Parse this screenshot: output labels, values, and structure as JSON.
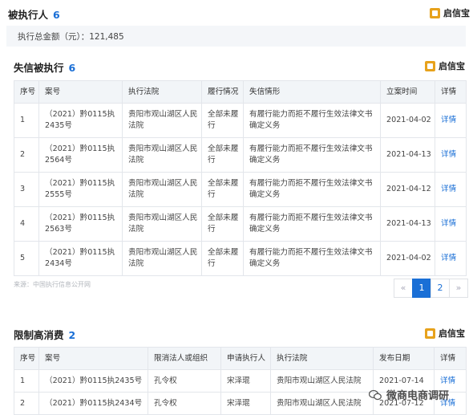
{
  "brand": {
    "name": "启信宝"
  },
  "executed": {
    "title": "被执行人",
    "count": "6",
    "total_label": "执行总金额（元）：121,485"
  },
  "dishonest": {
    "title": "失信被执行",
    "count": "6",
    "headers": [
      "序号",
      "案号",
      "执行法院",
      "履行情况",
      "失信情形",
      "立案时间",
      "详情"
    ],
    "rows": [
      {
        "no": "1",
        "case": "（2021）黔0115执2435号",
        "court": "贵阳市观山湖区人民法院",
        "status": "全部未履行",
        "situation": "有履行能力而拒不履行生效法律文书确定义务",
        "date": "2021-04-02",
        "detail": "详情"
      },
      {
        "no": "2",
        "case": "（2021）黔0115执2564号",
        "court": "贵阳市观山湖区人民法院",
        "status": "全部未履行",
        "situation": "有履行能力而拒不履行生效法律文书确定义务",
        "date": "2021-04-13",
        "detail": "详情"
      },
      {
        "no": "3",
        "case": "（2021）黔0115执2555号",
        "court": "贵阳市观山湖区人民法院",
        "status": "全部未履行",
        "situation": "有履行能力而拒不履行生效法律文书确定义务",
        "date": "2021-04-12",
        "detail": "详情"
      },
      {
        "no": "4",
        "case": "（2021）黔0115执2563号",
        "court": "贵阳市观山湖区人民法院",
        "status": "全部未履行",
        "situation": "有履行能力而拒不履行生效法律文书确定义务",
        "date": "2021-04-13",
        "detail": "详情"
      },
      {
        "no": "5",
        "case": "（2021）黔0115执2434号",
        "court": "贵阳市观山湖区人民法院",
        "status": "全部未履行",
        "situation": "有履行能力而拒不履行生效法律文书确定义务",
        "date": "2021-04-02",
        "detail": "详情"
      }
    ],
    "source": "来源：中国执行信息公开网",
    "pagination": {
      "prev": "«",
      "pages": [
        "1",
        "2"
      ],
      "current": "1",
      "next": "»"
    }
  },
  "restriction": {
    "title": "限制高消费",
    "count": "2",
    "headers": [
      "序号",
      "案号",
      "限消法人或组织",
      "申请执行人",
      "执行法院",
      "发布日期",
      "详情"
    ],
    "rows": [
      {
        "no": "1",
        "case": "（2021）黔0115执2435号",
        "person": "孔令权",
        "applicant": "宋泽琨",
        "court": "贵阳市观山湖区人民法院",
        "date": "2021-07-14",
        "detail": "详情"
      },
      {
        "no": "2",
        "case": "（2021）黔0115执2434号",
        "person": "孔令权",
        "applicant": "宋泽琨",
        "court": "贵阳市观山湖区人民法院",
        "date": "2021-07-12",
        "detail": "详情"
      }
    ]
  },
  "watermark": {
    "text": "微商电商调研"
  },
  "colors": {
    "accent": "#1a6fd6",
    "brand": "#e7a21c",
    "header_bg": "#f2f5f8"
  }
}
